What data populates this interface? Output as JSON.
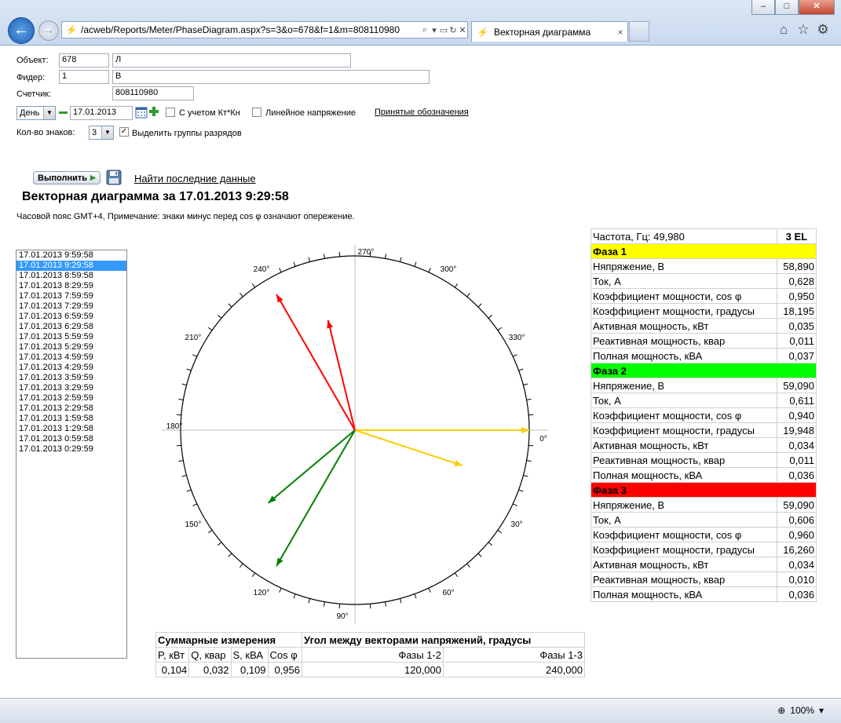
{
  "browser": {
    "url": "/acweb/Reports/Meter/PhaseDiagram.aspx?s=3&o=678&f=1&m=808110980",
    "tab_title": "Векторная диаграмма",
    "tab_close": "×",
    "back_glyph": "←",
    "forward_glyph": "→",
    "window_minimize": "–",
    "window_maximize": "□",
    "window_close": "✕",
    "zoom": "100%"
  },
  "form": {
    "object_label": "Объект:",
    "object_code": "678",
    "object_name": "Л",
    "feeder_label": "Фидер:",
    "feeder_code": "1",
    "feeder_name": "В                 ",
    "meter_label": "Счетчик:",
    "meter_value": "808110980",
    "period_value": "День",
    "date_value": "17.01.2013",
    "ktkn_label": "С учетом Кт*Кн",
    "linear_voltage_label": "Линейное напряжение",
    "legend_link": "Принятые обозначения",
    "digits_label": "Кол-во знаков:",
    "digits_value": "3",
    "highlight_groups_label": "Выделить группы разрядов",
    "highlight_groups_checked": "✓",
    "run_button": "Выполнить",
    "find_last_link": "Найти последние данные"
  },
  "report": {
    "title": "Векторная диаграмма за 17.01.2013 9:29:58",
    "note": "Часовой пояс GMT+4, Примечание: знаки минус перед cos φ означают опережение."
  },
  "time_list": [
    "17.01.2013 9:59:58",
    "17.01.2013 9:29:58",
    "17.01.2013 8:59:58",
    "17.01.2013 8:29:59",
    "17.01.2013 7:59:59",
    "17.01.2013 7:29:59",
    "17.01.2013 6:59:59",
    "17.01.2013 6:29:58",
    "17.01.2013 5:59:59",
    "17.01.2013 5:29:59",
    "17.01.2013 4:59:59",
    "17.01.2013 4:29:59",
    "17.01.2013 3:59:59",
    "17.01.2013 3:29:59",
    "17.01.2013 2:59:59",
    "17.01.2013 2:29:58",
    "17.01.2013 1:59:58",
    "17.01.2013 1:29:58",
    "17.01.2013 0:59:58",
    "17.01.2013 0:29:59"
  ],
  "time_list_selected": 1,
  "phase_table": {
    "freq_label": "Частота, Гц: 49,980",
    "meter_type": "3 EL",
    "phases": [
      {
        "name": "Фаза 1",
        "color": "#ffff00",
        "rows": [
          [
            "Няпряжение, В",
            "58,890"
          ],
          [
            "Ток, А",
            "0,628"
          ],
          [
            "Коэффициент мощности, cos φ",
            "0,950"
          ],
          [
            "Коэффициент мощности, градусы",
            "18,195"
          ],
          [
            "Активная мощность, кВт",
            "0,035"
          ],
          [
            "Реактивная мощность, квар",
            "0,011"
          ],
          [
            "Полная мощность, кВА",
            "0,037"
          ]
        ]
      },
      {
        "name": "Фаза 2",
        "color": "#00ff00",
        "rows": [
          [
            "Няпряжение, В",
            "59,090"
          ],
          [
            "Ток, А",
            "0,611"
          ],
          [
            "Коэффициент мощности, cos φ",
            "0,940"
          ],
          [
            "Коэффициент мощности, градусы",
            "19,948"
          ],
          [
            "Активная мощность, кВт",
            "0,034"
          ],
          [
            "Реактивная мощность, квар",
            "0,011"
          ],
          [
            "Полная мощность, кВА",
            "0,036"
          ]
        ]
      },
      {
        "name": "Фаза 3",
        "color": "#ff0000",
        "rows": [
          [
            "Няпряжение, В",
            "59,090"
          ],
          [
            "Ток, А",
            "0,606"
          ],
          [
            "Коэффициент мощности, cos φ",
            "0,960"
          ],
          [
            "Коэффициент мощности, градусы",
            "16,260"
          ],
          [
            "Активная мощность, кВт",
            "0,034"
          ],
          [
            "Реактивная мощность, квар",
            "0,010"
          ],
          [
            "Полная мощность, кВА",
            "0,036"
          ]
        ]
      }
    ]
  },
  "summary": {
    "header_left": "Суммарные измерения",
    "header_right": "Угол между векторами напряжений, градусы",
    "cols": [
      "P, кВт",
      "Q, квар",
      "S, кВА",
      "Cos φ",
      "Фазы 1-2",
      "Фазы 1-3"
    ],
    "vals": [
      "0,104",
      "0,032",
      "0,109",
      "0,956",
      "120,000",
      "240,000"
    ]
  },
  "diagram": {
    "angle_labels": [
      "270°",
      "300°",
      "330°",
      "0°",
      "30°",
      "60°",
      "90°",
      "120°",
      "150°",
      "180°",
      "210°",
      "240°"
    ],
    "colors": {
      "phase1": "#ffcc00",
      "phase2": "#008000",
      "phase3": "#ff0000",
      "axis": "#bbbbbb",
      "circle": "#000000"
    },
    "vectors": [
      {
        "name": "phase1-voltage",
        "angle": 0,
        "length": 1.0,
        "color": "#ffcc00"
      },
      {
        "name": "phase1-current",
        "angle": 18.195,
        "length": 0.65,
        "color": "#ffcc00"
      },
      {
        "name": "phase2-voltage",
        "angle": 120,
        "length": 0.9,
        "color": "#008000"
      },
      {
        "name": "phase2-current",
        "angle": 139.948,
        "length": 0.65,
        "color": "#008000"
      },
      {
        "name": "phase3-voltage",
        "angle": 240,
        "length": 0.9,
        "color": "#ff0000"
      },
      {
        "name": "phase3-current",
        "angle": 256.26,
        "length": 0.65,
        "color": "#ff0000"
      }
    ]
  }
}
